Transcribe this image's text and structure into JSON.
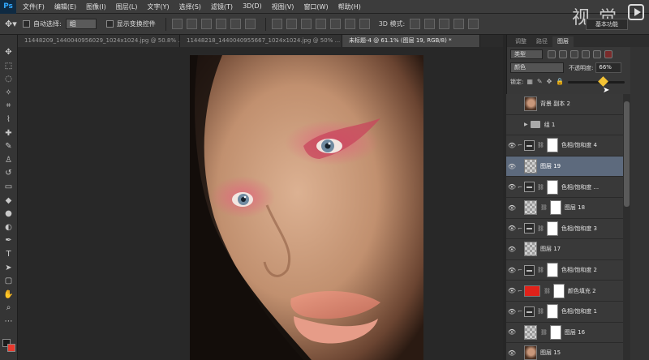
{
  "app": {
    "logo": "Ps"
  },
  "menu": [
    "文件(F)",
    "编辑(E)",
    "图像(I)",
    "图层(L)",
    "文字(Y)",
    "选择(S)",
    "滤镜(T)",
    "3D(D)",
    "视图(V)",
    "窗口(W)",
    "帮助(H)"
  ],
  "options": {
    "auto_select_label": "自动选择:",
    "auto_select_value": "组",
    "show_transform_label": "显示变换控件",
    "mode_3d_label": "3D 模式:",
    "workspace": "基本功能"
  },
  "watermark": "视 觉",
  "tabs": [
    {
      "label": "11448209_1440040956029_1024x1024.jpg @ 50.8% ...",
      "active": false
    },
    {
      "label": "11448218_1440040955667_1024x1024.jpg @ 50% ...",
      "active": false
    },
    {
      "label": "未标题-4 @ 61.1% (图层 19, RGB/8) *",
      "active": true
    }
  ],
  "panel": {
    "tabs": [
      {
        "label": "调整",
        "active": false
      },
      {
        "label": "路径",
        "active": false
      },
      {
        "label": "图层",
        "active": true
      }
    ],
    "filter_label": "类型",
    "blend_mode": "颜色",
    "opacity_label": "不透明度:",
    "opacity_value": "66%",
    "lock_label": "锁定:"
  },
  "layers": [
    {
      "name": "背景 副本 2",
      "kind": "face",
      "visible": false,
      "selected": false
    },
    {
      "name": "组 1",
      "kind": "group",
      "visible": false,
      "selected": false
    },
    {
      "name": "色相/饱和度 4",
      "kind": "adjust",
      "visible": true,
      "selected": false
    },
    {
      "name": "图层 19",
      "kind": "pixel",
      "visible": true,
      "selected": true
    },
    {
      "name": "色相/饱和度 ...",
      "kind": "adjust",
      "visible": true,
      "selected": false
    },
    {
      "name": "图层 18",
      "kind": "pixel-mask",
      "visible": true,
      "selected": false
    },
    {
      "name": "色相/饱和度 3",
      "kind": "adjust",
      "visible": true,
      "selected": false
    },
    {
      "name": "图层 17",
      "kind": "pixel",
      "visible": true,
      "selected": false
    },
    {
      "name": "色相/饱和度 2",
      "kind": "adjust",
      "visible": true,
      "selected": false
    },
    {
      "name": "颜色填充 2",
      "kind": "fill",
      "visible": true,
      "selected": false
    },
    {
      "name": "色相/饱和度 1",
      "kind": "adjust",
      "visible": true,
      "selected": false
    },
    {
      "name": "图层 16",
      "kind": "pixel-mask",
      "visible": true,
      "selected": false
    },
    {
      "name": "图层 15",
      "kind": "face",
      "visible": true,
      "selected": false
    }
  ],
  "colors": {
    "foreground": "#1b1b1b",
    "background": "#e8392d",
    "selected_layer": "#5d6a7d",
    "fill_layer": "#e0221a"
  }
}
